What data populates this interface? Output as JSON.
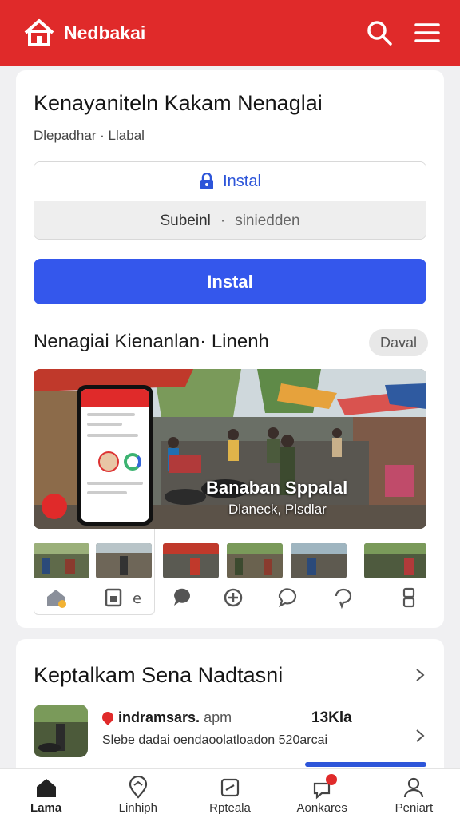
{
  "topbar": {
    "brand": "Nedbakai",
    "icons": [
      "home-logo-icon",
      "search-icon",
      "menu-icon"
    ],
    "color": "#e02a2a"
  },
  "app": {
    "title": "Kenayaniteln Kakam Nenaglai",
    "meta": "Dlepadhar · Llabal",
    "install_row_label": "Instal",
    "install_sub_left": "Subeinl",
    "install_sub_sep": "·",
    "install_sub_right": "siniedden",
    "install_button": "Instal",
    "accent": "#3457ec"
  },
  "preview": {
    "title": "Nenagiai Kienanlan· Linenh",
    "chip": "Daval",
    "caption": "Banaban Sppalal",
    "caption_sub": "Dlaneck, Plsdlar"
  },
  "related": {
    "title": "Keptalkam Sena Nadtasni",
    "item": {
      "name": "indramsars.",
      "name_sub": "apm",
      "size": "13Kla",
      "desc": "Slebe dadai oendaoolatloadon 520arcai"
    }
  },
  "bottomnav": {
    "items": [
      {
        "label": "Lama",
        "icon": "home-icon"
      },
      {
        "label": "Linhiph",
        "icon": "map-pin-icon"
      },
      {
        "label": "Rpteala",
        "icon": "box-icon"
      },
      {
        "label": "Aonkares",
        "icon": "bell-icon"
      },
      {
        "label": "Peniart",
        "icon": "user-icon"
      }
    ]
  }
}
